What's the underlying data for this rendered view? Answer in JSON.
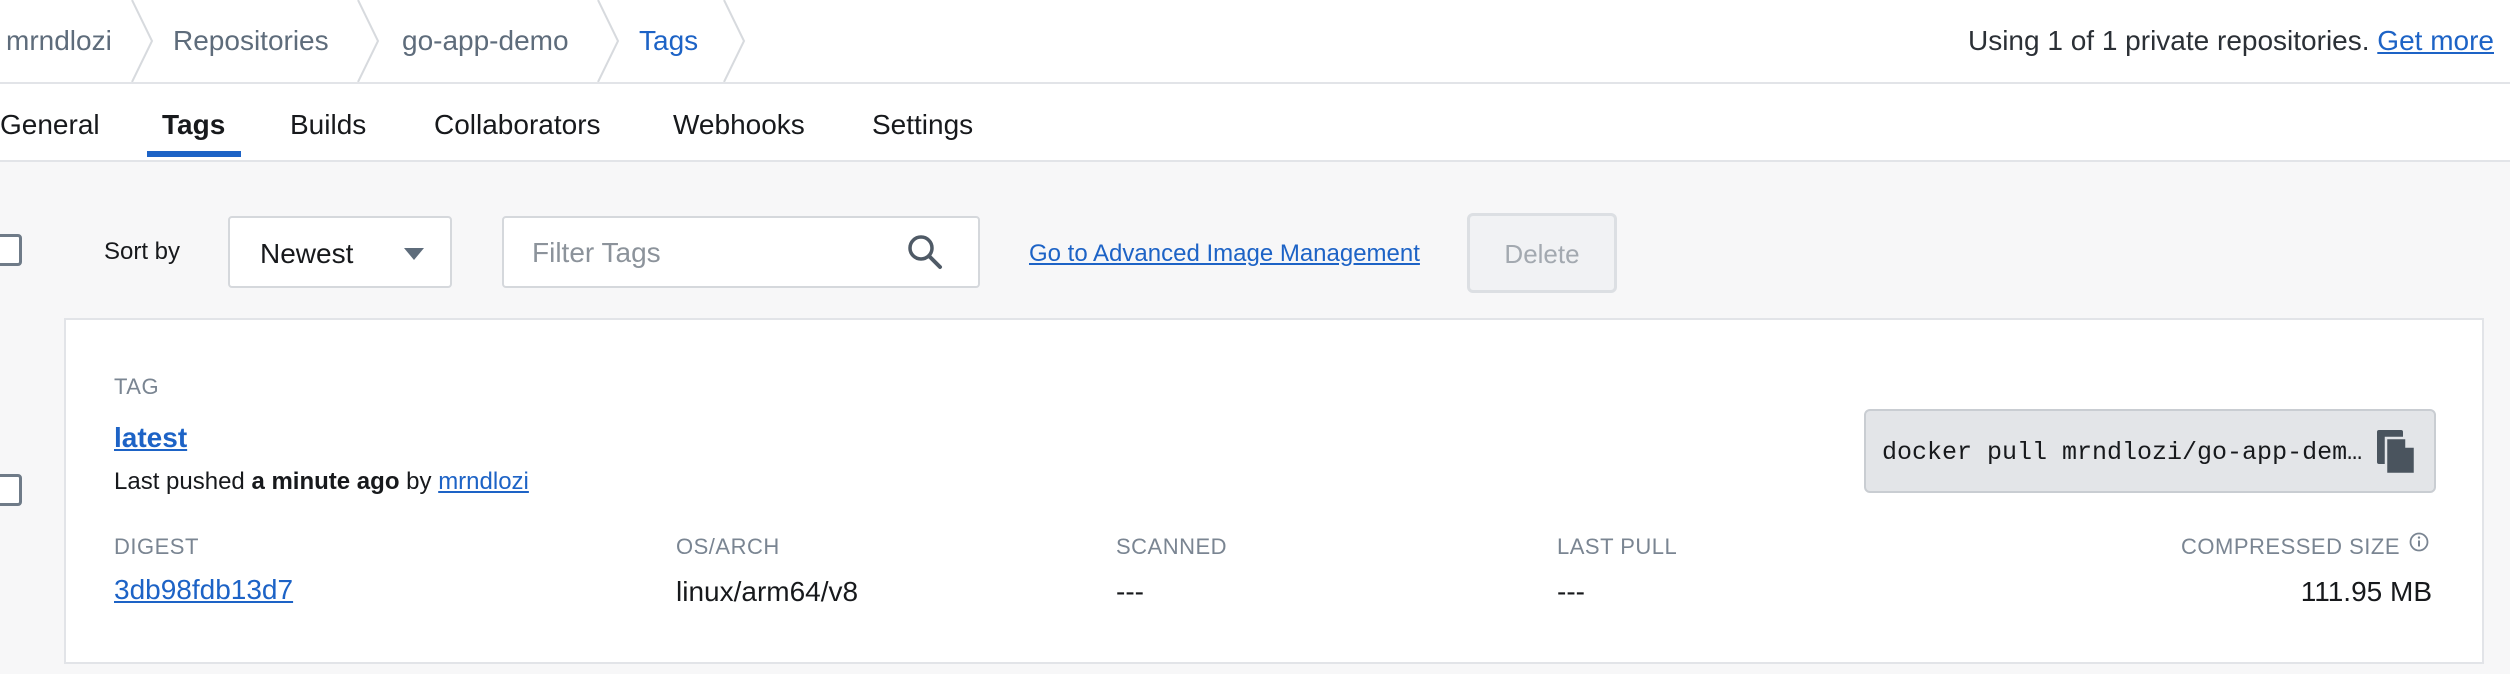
{
  "breadcrumb": [
    "mrndlozi",
    "Repositories",
    "go-app-demo",
    "Tags"
  ],
  "usage": {
    "text": "Using 1 of 1 private repositories.",
    "link": "Get more"
  },
  "tabs": [
    "General",
    "Tags",
    "Builds",
    "Collaborators",
    "Webhooks",
    "Settings"
  ],
  "active_tab": "Tags",
  "toolbar": {
    "sort_label": "Sort by",
    "sort_value": "Newest",
    "filter_placeholder": "Filter Tags",
    "advanced_link": "Go to Advanced Image Management",
    "delete_label": "Delete"
  },
  "tag": {
    "header": "TAG",
    "name": "latest",
    "pushed_prefix": "Last pushed",
    "pushed_time": "a minute ago",
    "pushed_by_word": "by",
    "pushed_by": "mrndlozi",
    "pull_command": "docker pull mrndlozi/go-app-demo:latest",
    "columns": {
      "digest": "DIGEST",
      "os_arch": "OS/ARCH",
      "scanned": "SCANNED",
      "last_pull": "LAST PULL",
      "compressed_size": "COMPRESSED SIZE"
    },
    "values": {
      "digest": "3db98fdb13d7",
      "os_arch": "linux/arm64/v8",
      "scanned": "---",
      "last_pull": "---",
      "compressed_size": "111.95 MB"
    }
  },
  "colors": {
    "accent": "#1d63c6",
    "background": "#f7f7f8"
  },
  "icons": [
    "chevron-separator-icon",
    "caret-down-icon",
    "search-icon",
    "copy-icon",
    "info-icon"
  ]
}
